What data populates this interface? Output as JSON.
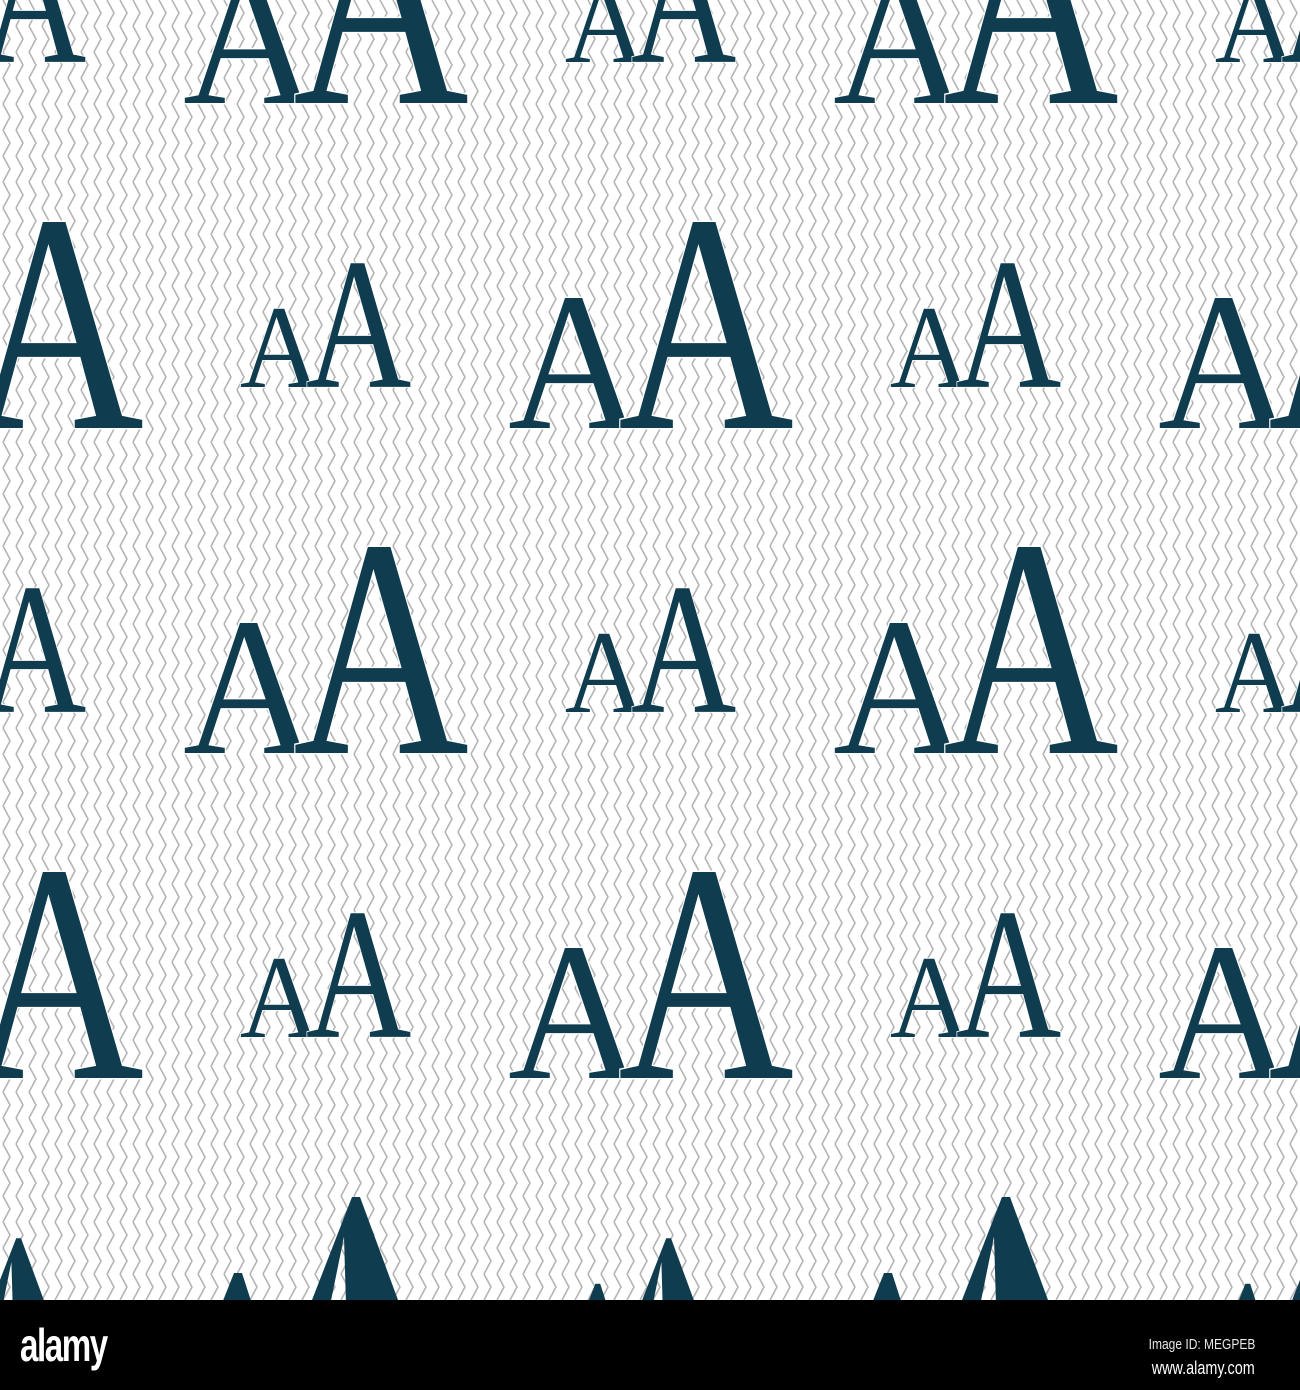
{
  "pattern": {
    "icon_name": "font-size-icon",
    "small_letter": "A",
    "large_letter": "A",
    "icon_color": "#0f3d4f",
    "line_color": "#b4b4b4",
    "background_color": "#ffffff"
  },
  "watermark": {
    "logo": "alamy",
    "image_id": "Image ID: MEGPEB",
    "website": "www.alamy.com"
  }
}
